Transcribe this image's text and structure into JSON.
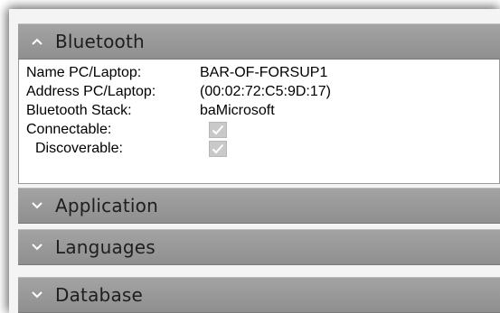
{
  "sections": {
    "bluetooth": {
      "title": "Bluetooth",
      "expanded": true,
      "fields": {
        "name_label": "Name PC/Laptop:",
        "name_value": "BAR-OF-FORSUP1",
        "address_label": "Address PC/Laptop:",
        "address_value": "(00:02:72:C5:9D:17)",
        "stack_label": "Bluetooth Stack:",
        "stack_value": "baMicrosoft",
        "connectable_label": "Connectable:",
        "connectable_checked": true,
        "discoverable_label": "Discoverable:",
        "discoverable_checked": true
      }
    },
    "application": {
      "title": "Application",
      "expanded": false
    },
    "languages": {
      "title": "Languages",
      "expanded": false
    },
    "database": {
      "title": "Database",
      "expanded": false
    }
  },
  "icons": {
    "expanded": "chevron-up-icon",
    "collapsed": "chevron-down-icon",
    "check": "checkmark-icon"
  },
  "colors": {
    "header_bg": "#999999",
    "panel_bg": "#f4f4f4",
    "checkbox_bg": "#c9c9c9"
  }
}
